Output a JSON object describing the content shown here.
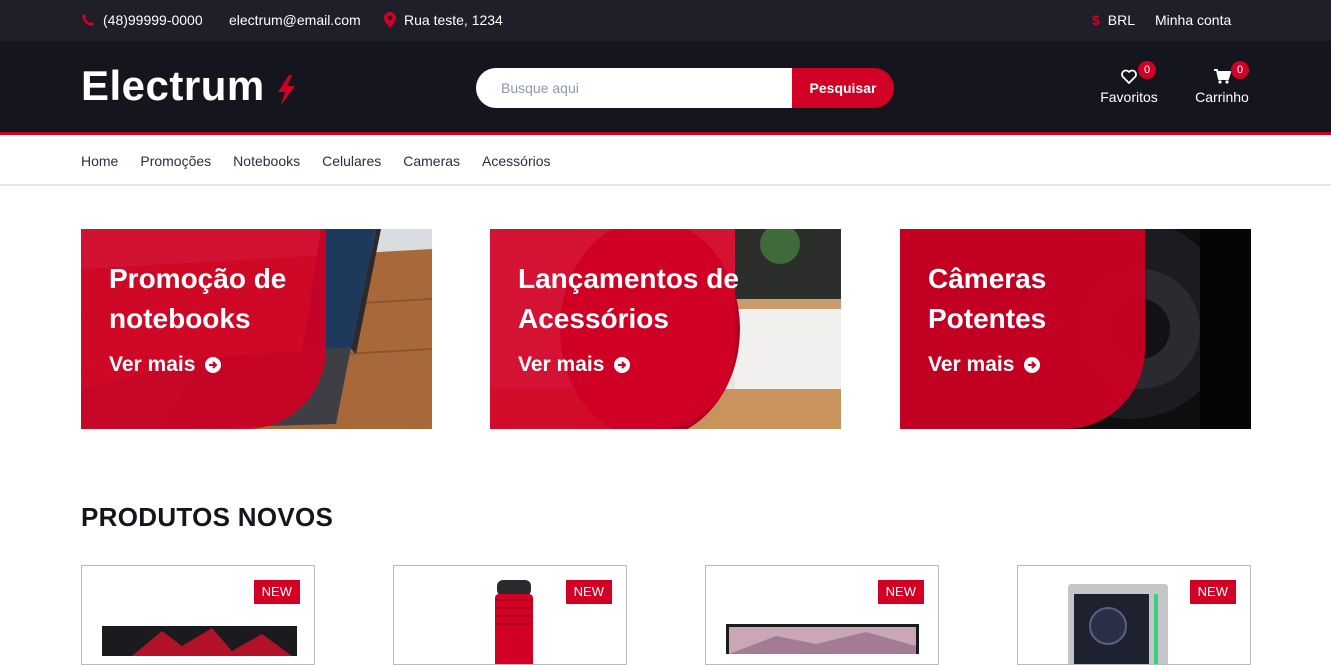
{
  "topbar": {
    "phone": "(48)99999-0000",
    "email": "electrum@email.com",
    "address": "Rua teste, 1234",
    "currency": "BRL",
    "account": "Minha conta"
  },
  "header": {
    "logo": "Electrum",
    "search_placeholder": "Busque aqui",
    "search_button": "Pesquisar",
    "favorites_label": "Favoritos",
    "favorites_count": "0",
    "cart_label": "Carrinho",
    "cart_count": "0"
  },
  "nav": {
    "items": [
      "Home",
      "Promoções",
      "Notebooks",
      "Celulares",
      "Cameras",
      "Acessórios"
    ]
  },
  "banners": [
    {
      "title": "Promoção de notebooks",
      "link": "Ver mais"
    },
    {
      "title": "Lançamentos de Acessórios",
      "link": "Ver mais"
    },
    {
      "title": "Câmeras Potentes",
      "link": "Ver mais"
    }
  ],
  "products_section": {
    "title": "PRODUTOS NOVOS",
    "items": [
      {
        "tag": "NEW"
      },
      {
        "tag": "NEW"
      },
      {
        "tag": "NEW"
      },
      {
        "tag": "NEW"
      }
    ]
  },
  "colors": {
    "accent": "#d10024",
    "topbar": "#1e1f29",
    "header": "#15161d"
  }
}
